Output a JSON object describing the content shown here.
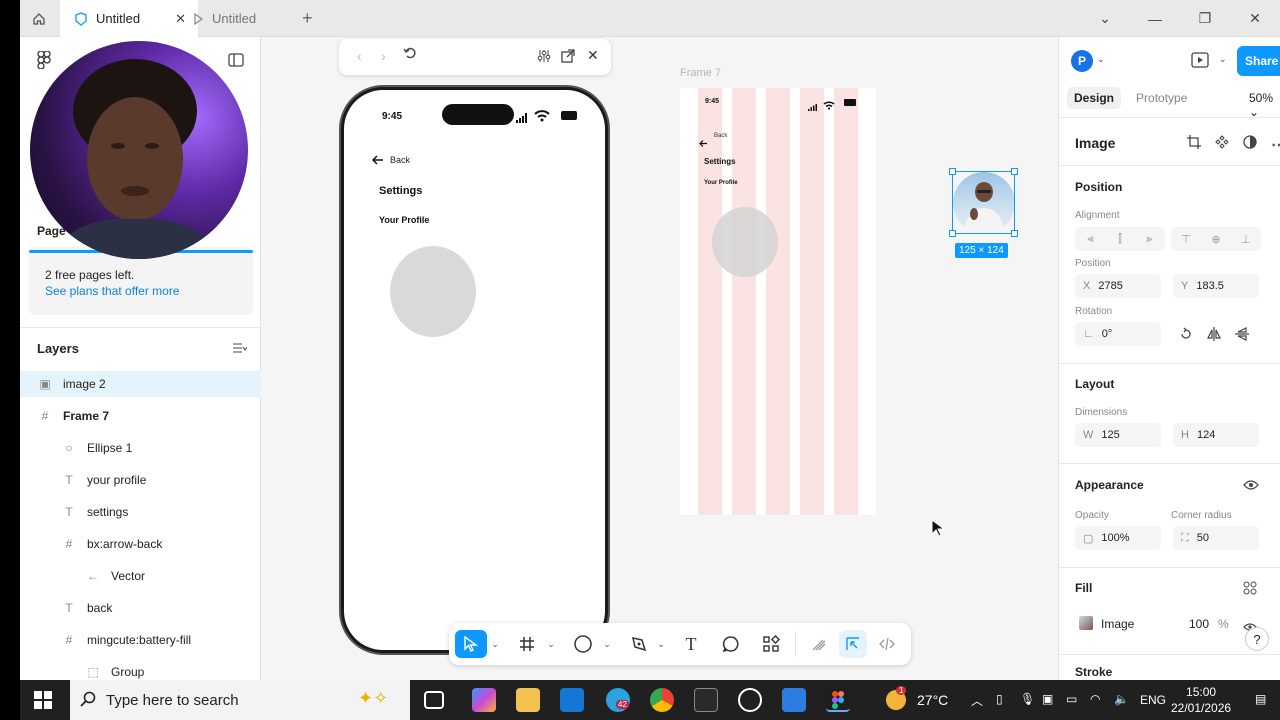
{
  "tabs": {
    "home_icon": "home-icon",
    "items": [
      {
        "label": "Untitled",
        "active": true
      },
      {
        "label": "Untitled",
        "active": false
      }
    ]
  },
  "left": {
    "page_label": "Page",
    "free_pages": "2 free pages left.",
    "plans_link": "See plans that offer more",
    "layers_title": "Layers",
    "layers": [
      {
        "name": "image 2",
        "icon": "image-icon",
        "indent": 0,
        "bold": false,
        "selected": true
      },
      {
        "name": "Frame 7",
        "icon": "frame-icon",
        "indent": 0,
        "bold": true,
        "selected": false
      },
      {
        "name": "Ellipse 1",
        "icon": "ellipse-icon",
        "indent": 1,
        "bold": false,
        "selected": false
      },
      {
        "name": "your profile",
        "icon": "text-icon",
        "indent": 1,
        "bold": false,
        "selected": false
      },
      {
        "name": "settings",
        "icon": "text-icon",
        "indent": 1,
        "bold": false,
        "selected": false
      },
      {
        "name": "bx:arrow-back",
        "icon": "frame-icon",
        "indent": 1,
        "bold": false,
        "selected": false
      },
      {
        "name": "Vector",
        "icon": "arrow-left-icon",
        "indent": 2,
        "bold": false,
        "selected": false
      },
      {
        "name": "back",
        "icon": "text-icon",
        "indent": 1,
        "bold": false,
        "selected": false
      },
      {
        "name": "mingcute:battery-fill",
        "icon": "frame-icon",
        "indent": 1,
        "bold": false,
        "selected": false
      },
      {
        "name": "Group",
        "icon": "group-icon",
        "indent": 2,
        "bold": false,
        "selected": false
      }
    ]
  },
  "phone": {
    "time": "9:45",
    "back": "Back",
    "settings": "Settings",
    "profile": "Your Profile"
  },
  "frame7": {
    "label": "Frame 7",
    "time": "9:45",
    "back": "Back",
    "settings": "Settings",
    "profile": "Your Profile"
  },
  "selection": {
    "dimensions": "125 × 124"
  },
  "right": {
    "avatar": "P",
    "share": "Share",
    "tab_design": "Design",
    "tab_prototype": "Prototype",
    "zoom": "50%",
    "section_title": "Image",
    "position_title": "Position",
    "alignment_label": "Alignment",
    "position_label": "Position",
    "x_label": "X",
    "x_value": "2785",
    "y_label": "Y",
    "y_value": "183.5",
    "rotation_label": "Rotation",
    "rotation_value": "0°",
    "layout_title": "Layout",
    "dimensions_label": "Dimensions",
    "w_label": "W",
    "w_value": "125",
    "h_label": "H",
    "h_value": "124",
    "appearance_title": "Appearance",
    "opacity_label": "Opacity",
    "opacity_value": "100%",
    "radius_label": "Corner radius",
    "radius_value": "50",
    "fill_title": "Fill",
    "fill_type": "Image",
    "fill_opacity": "100",
    "fill_unit": "%",
    "stroke_title": "Stroke",
    "help": "?"
  },
  "taskbar": {
    "search_placeholder": "Type here to search",
    "temperature": "27°C",
    "language": "ENG",
    "time": "15:00",
    "date": "22/01/2026",
    "telegram_badge": "42",
    "weather_badge": "1"
  },
  "colors": {
    "accent": "#0d99ff",
    "layout_grid": "#fbe3e3"
  }
}
